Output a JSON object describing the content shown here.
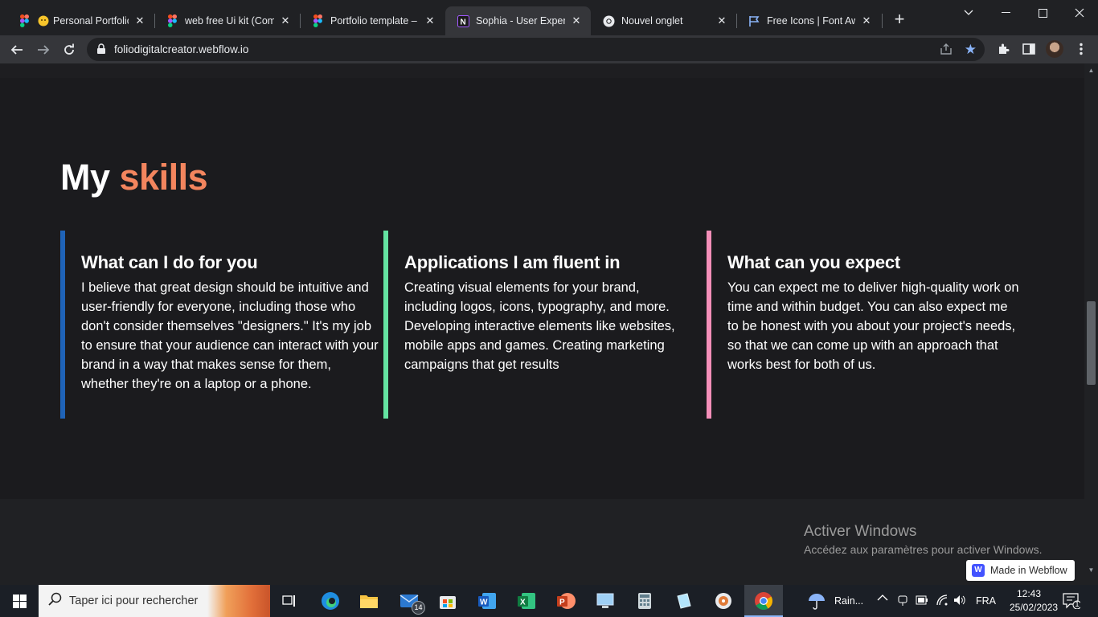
{
  "browser": {
    "tabs": [
      {
        "title": "Personal Portfolio",
        "icon": "figma-icon"
      },
      {
        "title": "web free Ui kit (Comm",
        "icon": "figma-icon"
      },
      {
        "title": "Portfolio template – Fi",
        "icon": "figma-icon"
      },
      {
        "title": "Sophia - User Experien",
        "icon": "notion-icon",
        "active": true
      },
      {
        "title": "Nouvel onglet",
        "icon": "chrome-icon"
      },
      {
        "title": "Free Icons | Font Awes",
        "icon": "flag-icon"
      }
    ],
    "url": "foliodigitalcreator.webflow.io",
    "bookmarked": true
  },
  "page": {
    "heading_prefix": "My",
    "heading_accent": "skills",
    "accent_color": "#f3855e",
    "cards": [
      {
        "title": "What can I do for you",
        "body": "I believe that great design should be intuitive and user-friendly for everyone, including those who don't consider themselves \"designers.\" It's my job to ensure that your audience can interact with your brand in a way that makes sense for them, whether they're on a laptop or a phone.",
        "bar_color": "#1f63b7"
      },
      {
        "title": "Applications I am fluent in",
        "body": "Creating visual elements for your brand, including logos, icons, typography, and more. Developing interactive elements like websites, mobile apps and games. Creating marketing campaigns that get results",
        "bar_color": "#64e3a1"
      },
      {
        "title": "What can you expect",
        "body": "You can expect me to deliver high-quality work on time and within budget. You can also expect me to be honest with you about your project's needs, so that we can come up with an approach that works best for both of us.",
        "bar_color": "#f48fb9"
      }
    ],
    "webflow_badge": "Made in Webflow"
  },
  "os": {
    "activation_title": "Activer Windows",
    "activation_sub": "Accédez aux paramètres pour activer Windows.",
    "search_placeholder": "Taper ici pour rechercher",
    "mail_badge": "14",
    "weather": "Rain...",
    "language": "FRA",
    "time": "12:43",
    "date": "25/02/2023",
    "notification_count": "1"
  }
}
